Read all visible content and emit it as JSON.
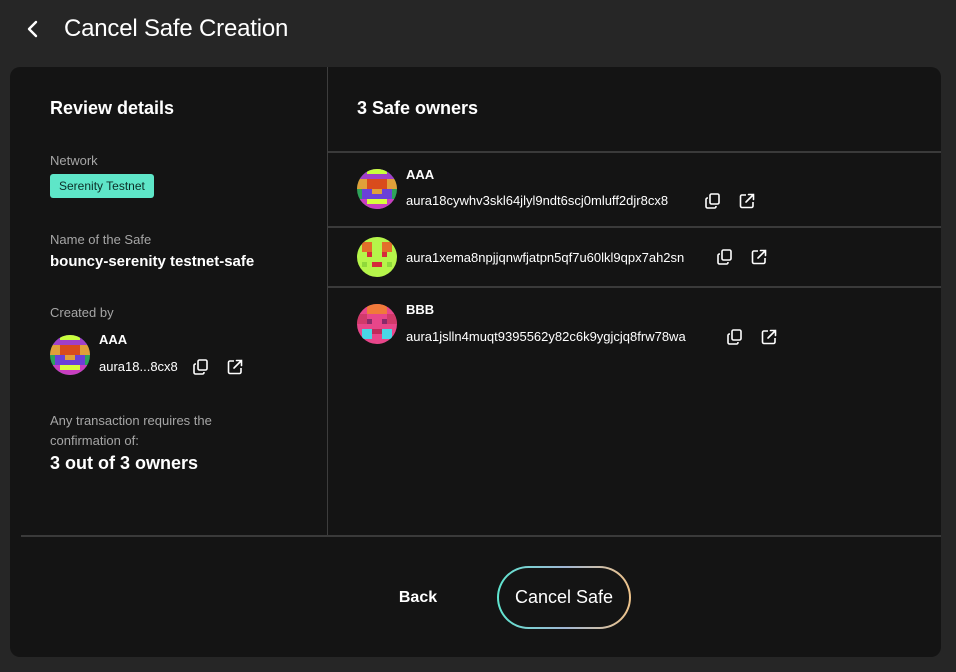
{
  "header": {
    "title": "Cancel Safe Creation"
  },
  "review": {
    "title": "Review details",
    "network_label": "Network",
    "network_value": "Serenity Testnet",
    "name_label": "Name of the Safe",
    "name_value": "bouncy-serenity testnet-safe",
    "created_label": "Created by",
    "creator": {
      "name": "AAA",
      "address": "aura18...8cx8",
      "avatar_color": "#7a3fd0"
    },
    "confirm_text": "Any transaction requires the confirmation of:",
    "confirm_value": "3 out of 3 owners"
  },
  "owners": {
    "title": "3 Safe owners",
    "items": [
      {
        "name": "AAA",
        "address": "aura18cywhv3skl64jlyl9ndt6scj0mluff2djr8cx8",
        "icon": "identicon-purple"
      },
      {
        "name": "",
        "address": "aura1xema8npjjqnwfjatpn5qf7u60lkl9qpx7ah2sn",
        "icon": "identicon-lime"
      },
      {
        "name": "BBB",
        "address": "aura1jslln4muqt9395562y82c6k9ygjcjq8frw78wa",
        "icon": "identicon-pink"
      }
    ]
  },
  "actions": {
    "back_label": "Back",
    "cancel_label": "Cancel Safe"
  },
  "colors": {
    "accent_badge": "#5ee6c8",
    "background": "#262626",
    "card": "#141414"
  }
}
